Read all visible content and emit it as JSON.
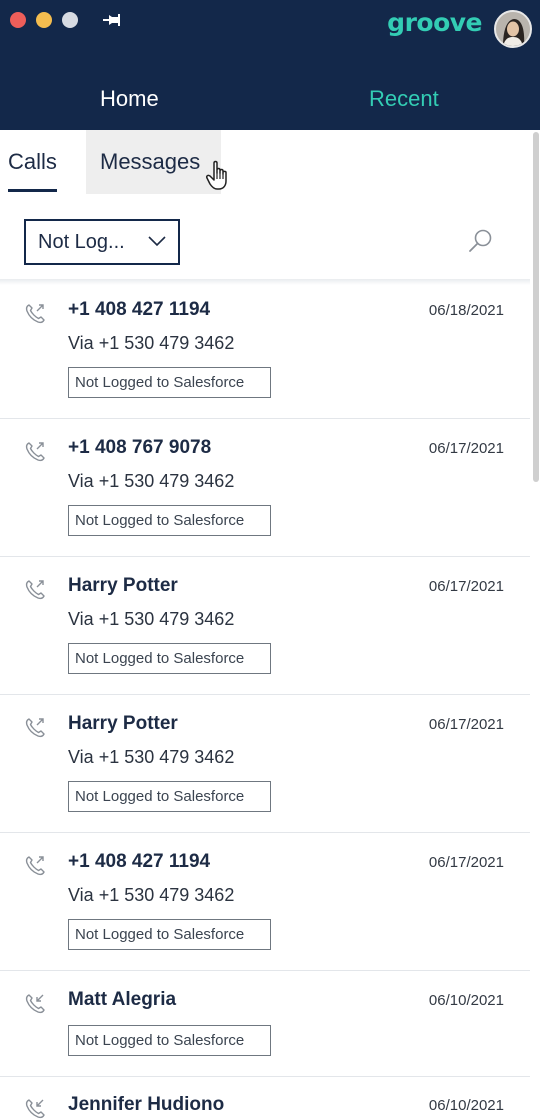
{
  "header": {
    "brand": "groove",
    "nav": [
      {
        "label": "Home"
      },
      {
        "label": "Recent"
      }
    ]
  },
  "subtabs": {
    "calls": "Calls",
    "messages": "Messages"
  },
  "filter": {
    "value": "Not Log..."
  },
  "calls": [
    {
      "name": "+1 408 427 1194",
      "date": "06/18/2021",
      "via": "Via +1 530 479 3462",
      "status": "Not Logged to Salesforce",
      "direction": "outgoing"
    },
    {
      "name": "+1 408 767 9078",
      "date": "06/17/2021",
      "via": "Via +1 530 479 3462",
      "status": "Not Logged to Salesforce",
      "direction": "outgoing"
    },
    {
      "name": "Harry Potter",
      "date": "06/17/2021",
      "via": "Via +1 530 479 3462",
      "status": "Not Logged to Salesforce",
      "direction": "outgoing"
    },
    {
      "name": "Harry Potter",
      "date": "06/17/2021",
      "via": "Via +1 530 479 3462",
      "status": "Not Logged to Salesforce",
      "direction": "outgoing"
    },
    {
      "name": "+1 408 427 1194",
      "date": "06/17/2021",
      "via": "Via +1 530 479 3462",
      "status": "Not Logged to Salesforce",
      "direction": "outgoing"
    },
    {
      "name": "Matt Alegria",
      "date": "06/10/2021",
      "via": "",
      "status": "Not Logged to Salesforce",
      "direction": "incoming"
    },
    {
      "name": "Jennifer Hudiono",
      "date": "06/10/2021",
      "via": "",
      "status": "",
      "direction": "incoming"
    }
  ],
  "icons": {
    "outgoing": "phone-outgoing-icon",
    "incoming": "phone-incoming-icon"
  },
  "colors": {
    "header_bg": "#13284a",
    "accent": "#33cdb4"
  }
}
